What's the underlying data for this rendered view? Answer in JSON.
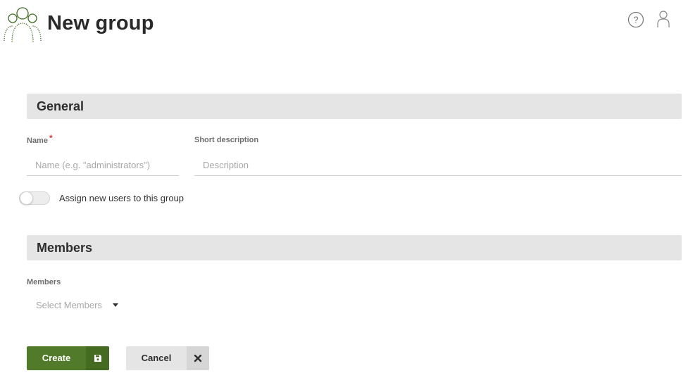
{
  "header": {
    "title": "New group",
    "logo_icon": "users-group-icon",
    "help_icon": "help-circle-icon",
    "user_icon": "user-icon"
  },
  "general": {
    "heading": "General",
    "name_label": "Name",
    "name_required_mark": "*",
    "name_placeholder": "Name (e.g. \"administrators\")",
    "name_value": "",
    "description_label": "Short description",
    "description_placeholder": "Description",
    "description_value": "",
    "assign_toggle_label": "Assign new users to this group",
    "assign_toggle_on": false
  },
  "members": {
    "heading": "Members",
    "members_label": "Members",
    "select_placeholder": "Select Members"
  },
  "actions": {
    "create_label": "Create",
    "create_icon": "save-icon",
    "cancel_label": "Cancel",
    "cancel_icon": "close-icon"
  },
  "colors": {
    "accent": "#517a2a",
    "section_bg": "#e5e5e5",
    "required": "#e03a3a"
  }
}
